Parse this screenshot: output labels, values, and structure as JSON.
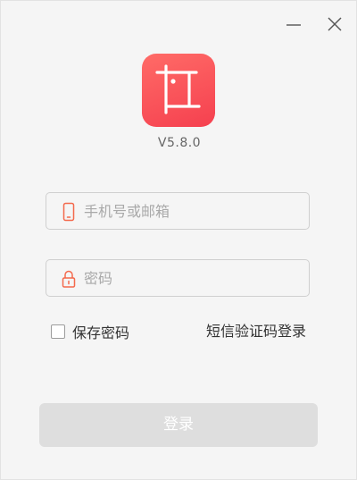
{
  "app": {
    "version": "V5.8.0"
  },
  "window_controls": {
    "minimize_icon": "minimize-icon",
    "close_icon": "close-icon"
  },
  "logo": {
    "icon": "app-logo",
    "gradient_start": "#ff6b67",
    "gradient_end": "#f5404f"
  },
  "form": {
    "account": {
      "icon": "phone-icon",
      "placeholder": "手机号或邮箱",
      "value": ""
    },
    "password": {
      "icon": "lock-icon",
      "placeholder": "密码",
      "value": ""
    },
    "remember": {
      "label": "保存密码",
      "checked": false
    },
    "sms_login_link": "短信验证码登录",
    "submit_label": "登录"
  },
  "colors": {
    "accent": "#f4694c",
    "button_disabled": "#dedede"
  }
}
